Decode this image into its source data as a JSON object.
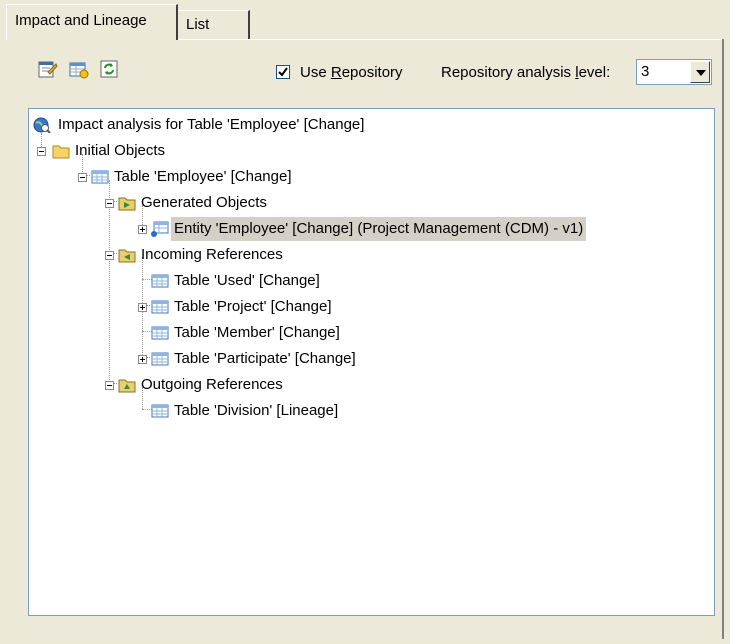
{
  "tabs": [
    {
      "label": "Impact and Lineage",
      "active": true
    },
    {
      "label": "List",
      "active": false
    }
  ],
  "toolbar": {
    "icons": [
      "properties-icon",
      "generate-model-icon",
      "refresh-icon"
    ],
    "use_repository": {
      "checked": true,
      "label_prefix": "Use ",
      "label_access": "R",
      "label_suffix": "epository"
    },
    "level": {
      "label_prefix": "Repository analysis ",
      "label_access": "l",
      "label_suffix": "evel:",
      "value": "3"
    }
  },
  "tree": {
    "root": "Impact analysis for Table 'Employee' [Change]",
    "initial_objects": "Initial Objects",
    "employee": "Table 'Employee' [Change]",
    "generated_objects": "Generated Objects",
    "entity_employee": "Entity 'Employee' [Change] (Project Management (CDM) - v1)",
    "incoming_references": "Incoming References",
    "used": "Table 'Used' [Change]",
    "project": "Table 'Project' [Change]",
    "member": "Table 'Member' [Change]",
    "participate": "Table 'Participate' [Change]",
    "outgoing_references": "Outgoing References",
    "division": "Table 'Division' [Lineage]"
  }
}
